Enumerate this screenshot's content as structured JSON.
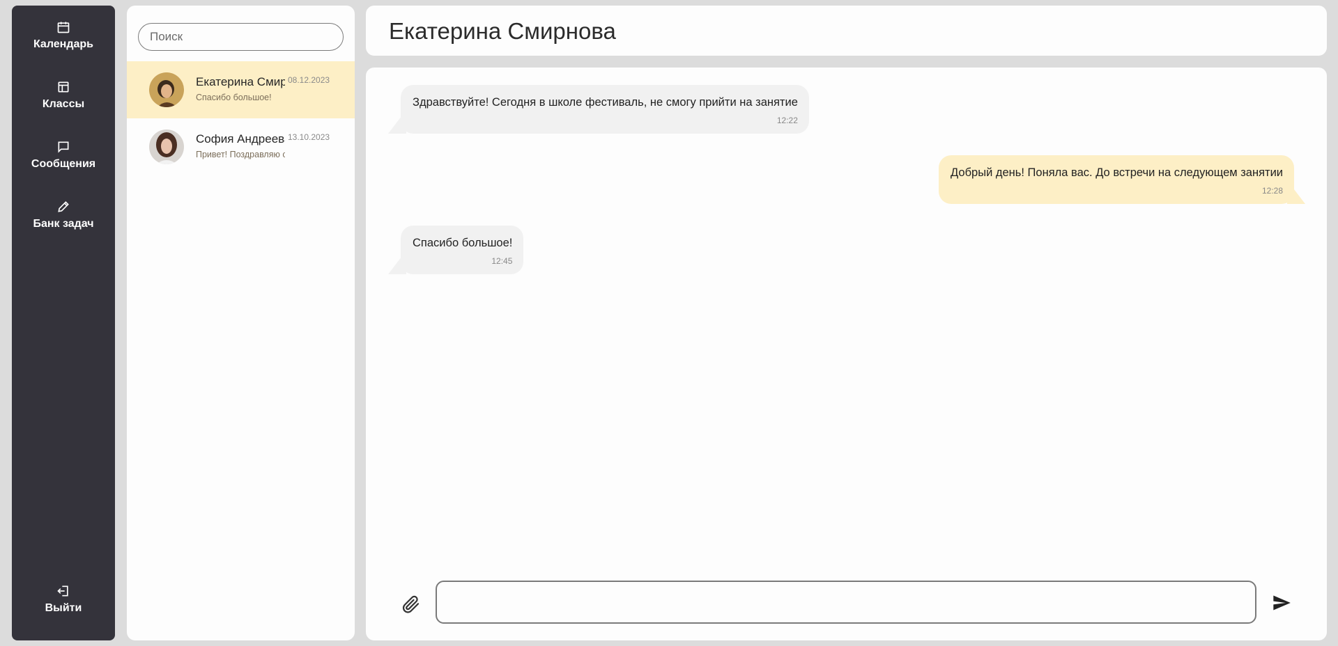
{
  "nav": {
    "items": [
      {
        "label": "Календарь",
        "icon": "calendar-icon"
      },
      {
        "label": "Классы",
        "icon": "layout-icon"
      },
      {
        "label": "Сообщения",
        "icon": "chat-bubble-icon"
      },
      {
        "label": "Банк задач",
        "icon": "pencil-icon"
      }
    ],
    "logout": {
      "label": "Выйти",
      "icon": "logout-icon"
    }
  },
  "contacts": {
    "search_placeholder": "Поиск",
    "items": [
      {
        "name": "Екатерина Смирнова",
        "date": "08.12.2023",
        "preview": "Спасибо большое!",
        "active": true
      },
      {
        "name": "София Андреева",
        "date": "13.10.2023",
        "preview": "Привет! Поздравляю с праздником!",
        "active": false
      }
    ]
  },
  "header": {
    "title": "Екатерина Смирнова"
  },
  "chat": {
    "messages": [
      {
        "direction": "in",
        "text": "Здравствуйте! Сегодня в школе фестиваль, не смогу прийти на занятие",
        "time": "12:22"
      },
      {
        "direction": "out",
        "text": "Добрый день! Поняла вас. До встречи на следующем занятии",
        "time": "12:28"
      },
      {
        "direction": "in",
        "text": "Спасибо большое!",
        "time": "12:45"
      }
    ],
    "composer_placeholder": ""
  },
  "colors": {
    "nav_bg": "#34333b",
    "page_bg": "#dcdcdc",
    "active_bg": "#fdefc6",
    "incoming_bg": "#f1f1f1",
    "outgoing_bg": "#fdefc6"
  }
}
